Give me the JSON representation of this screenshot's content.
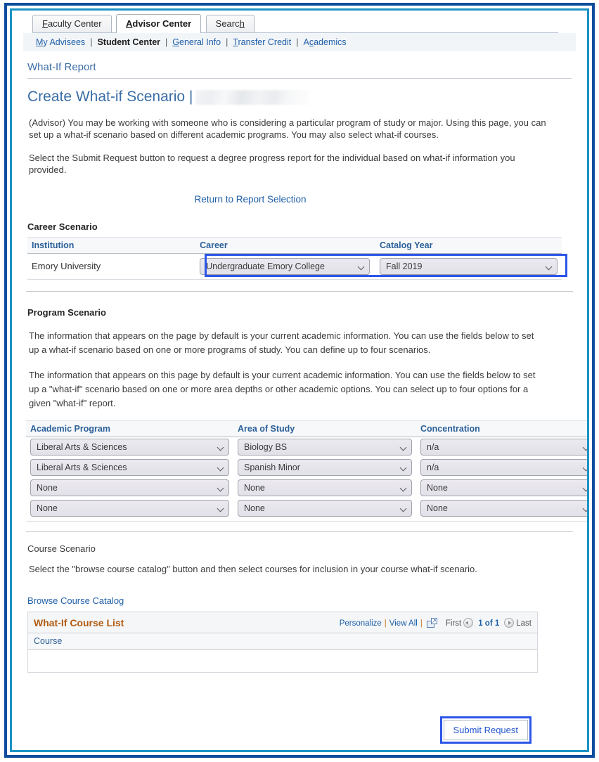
{
  "tabs": [
    {
      "label": "Faculty Center",
      "accesskey_index": 0,
      "active": false
    },
    {
      "label": "Advisor Center",
      "accesskey_index": 0,
      "active": true
    },
    {
      "label": "Search",
      "accesskey_index": 5,
      "active": false
    }
  ],
  "subnav": {
    "items": [
      {
        "label": "My Advisees",
        "current": false
      },
      {
        "label": "Student Center",
        "current": true
      },
      {
        "label": "General Info",
        "current": false
      },
      {
        "label": "Transfer Credit",
        "current": false
      },
      {
        "label": "Academics",
        "current": false
      }
    ],
    "separator": "|"
  },
  "page": {
    "breadcrumb_title": "What-If Report",
    "heading": "Create What-if Scenario |",
    "intro_paragraph_1": "(Advisor) You may be working with someone who is considering a particular program of study or major. Using this page, you can set up a what-if scenario based on different academic programs. You may also select what-if courses.",
    "intro_paragraph_2": "Select the Submit Request button to request a degree progress report for the individual based on what-if information you provided.",
    "return_link": "Return to Report Selection"
  },
  "career_scenario": {
    "heading": "Career Scenario",
    "columns": [
      "Institution",
      "Career",
      "Catalog Year"
    ],
    "row": {
      "institution": "Emory University",
      "career": "Undergraduate Emory College",
      "catalog_year": "Fall 2019"
    }
  },
  "program_scenario": {
    "heading": "Program Scenario",
    "paragraph_1": "The information that appears on the page by default is your current academic information. You can use the fields below to set up a what-if scenario based on one or more programs of study. You can define up to four scenarios.",
    "paragraph_2": "The information that appears on this page by default is your current academic information. You can use the fields below to set up a \"what-if\" scenario based on one or more area depths or other academic options. You can select up to four options for a given \"what-if\" report.",
    "columns": [
      "Academic Program",
      "Area of Study",
      "Concentration"
    ],
    "rows": [
      {
        "program": "Liberal Arts & Sciences",
        "area": "Biology BS",
        "concentration": "n/a"
      },
      {
        "program": "Liberal Arts & Sciences",
        "area": "Spanish Minor",
        "concentration": "n/a"
      },
      {
        "program": "None",
        "area": "None",
        "concentration": "None"
      },
      {
        "program": "None",
        "area": "None",
        "concentration": "None"
      }
    ]
  },
  "course_scenario": {
    "heading": "Course Scenario",
    "paragraph": "Select the \"browse course catalog\" button and then select courses for inclusion in your course what-if scenario.",
    "browse_link": "Browse Course Catalog"
  },
  "course_list": {
    "title": "What-If Course List",
    "personalize_label": "Personalize",
    "view_all_label": "View All",
    "separator": "|",
    "expand_icon": "expand-window-icon",
    "first_label": "First",
    "last_label": "Last",
    "page_indicator": "1 of 1",
    "column": "Course",
    "rows": []
  },
  "footer": {
    "submit_label": "Submit Request"
  },
  "colors": {
    "frame_outer": "#0d4d9e",
    "frame_inner": "#1c93c4",
    "highlight": "#2b56e8",
    "link": "#1f5fa8",
    "grid_title": "#b35b12",
    "heading": "#3a6ea5"
  }
}
